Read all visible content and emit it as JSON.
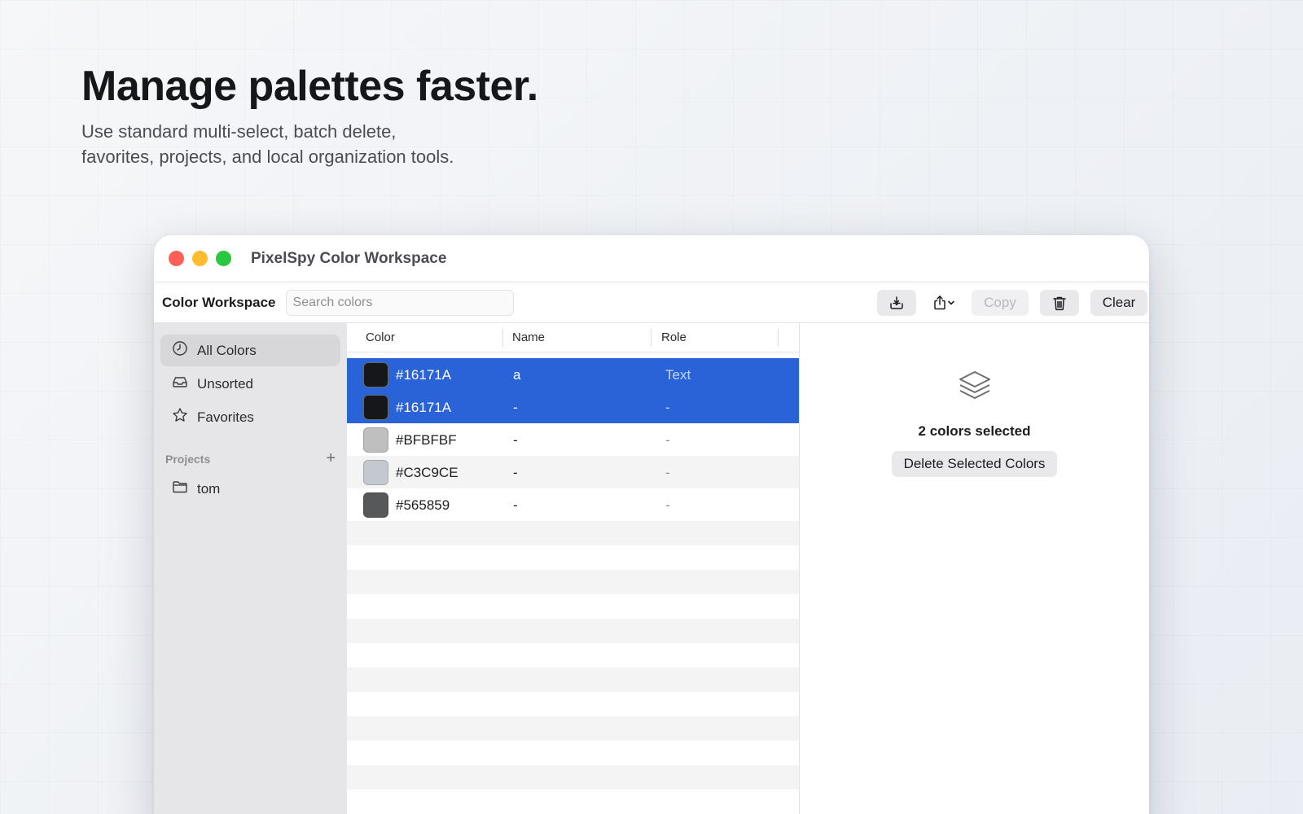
{
  "hero": {
    "title": "Manage palettes faster.",
    "subtitle_line1": "Use standard multi-select, batch delete,",
    "subtitle_line2": "favorites, projects, and local organization tools."
  },
  "window": {
    "title": "PixelSpy Color Workspace"
  },
  "toolbar": {
    "title": "Color Workspace",
    "search_placeholder": "Search colors",
    "import_icon": "tray-download-icon",
    "share_icon": "share-icon",
    "copy_label": "Copy",
    "delete_icon": "trash-icon",
    "clear_label": "Clear"
  },
  "sidebar": {
    "items": [
      {
        "label": "All Colors",
        "icon": "clock-icon",
        "active": true
      },
      {
        "label": "Unsorted",
        "icon": "inbox-icon",
        "active": false
      },
      {
        "label": "Favorites",
        "icon": "star-icon",
        "active": false
      }
    ],
    "projects_header": "Projects",
    "projects_add": "+",
    "projects": [
      {
        "label": "tom",
        "icon": "folder-icon"
      }
    ]
  },
  "table": {
    "columns": [
      "Color",
      "Name",
      "Role"
    ],
    "rows": [
      {
        "hex": "#16171A",
        "swatch": "#16171A",
        "name": "a",
        "role": "Text",
        "selected": true
      },
      {
        "hex": "#16171A",
        "swatch": "#16171A",
        "name": "-",
        "role": "-",
        "selected": true
      },
      {
        "hex": "#BFBFBF",
        "swatch": "#BFBFBF",
        "name": "-",
        "role": "-",
        "selected": false
      },
      {
        "hex": "#C3C9CE",
        "swatch": "#C3C9CE",
        "name": "-",
        "role": "-",
        "selected": false
      },
      {
        "hex": "#565859",
        "swatch": "#565859",
        "name": "-",
        "role": "-",
        "selected": false
      }
    ]
  },
  "detail": {
    "icon": "layers-icon",
    "count_label": "2 colors selected",
    "delete_button": "Delete Selected Colors"
  },
  "colors": {
    "selection": "#2A62D8",
    "sidebar_bg": "#E6E6E8",
    "close": "#FF5F57",
    "minimize": "#FEBC2E",
    "zoom": "#28C840"
  }
}
